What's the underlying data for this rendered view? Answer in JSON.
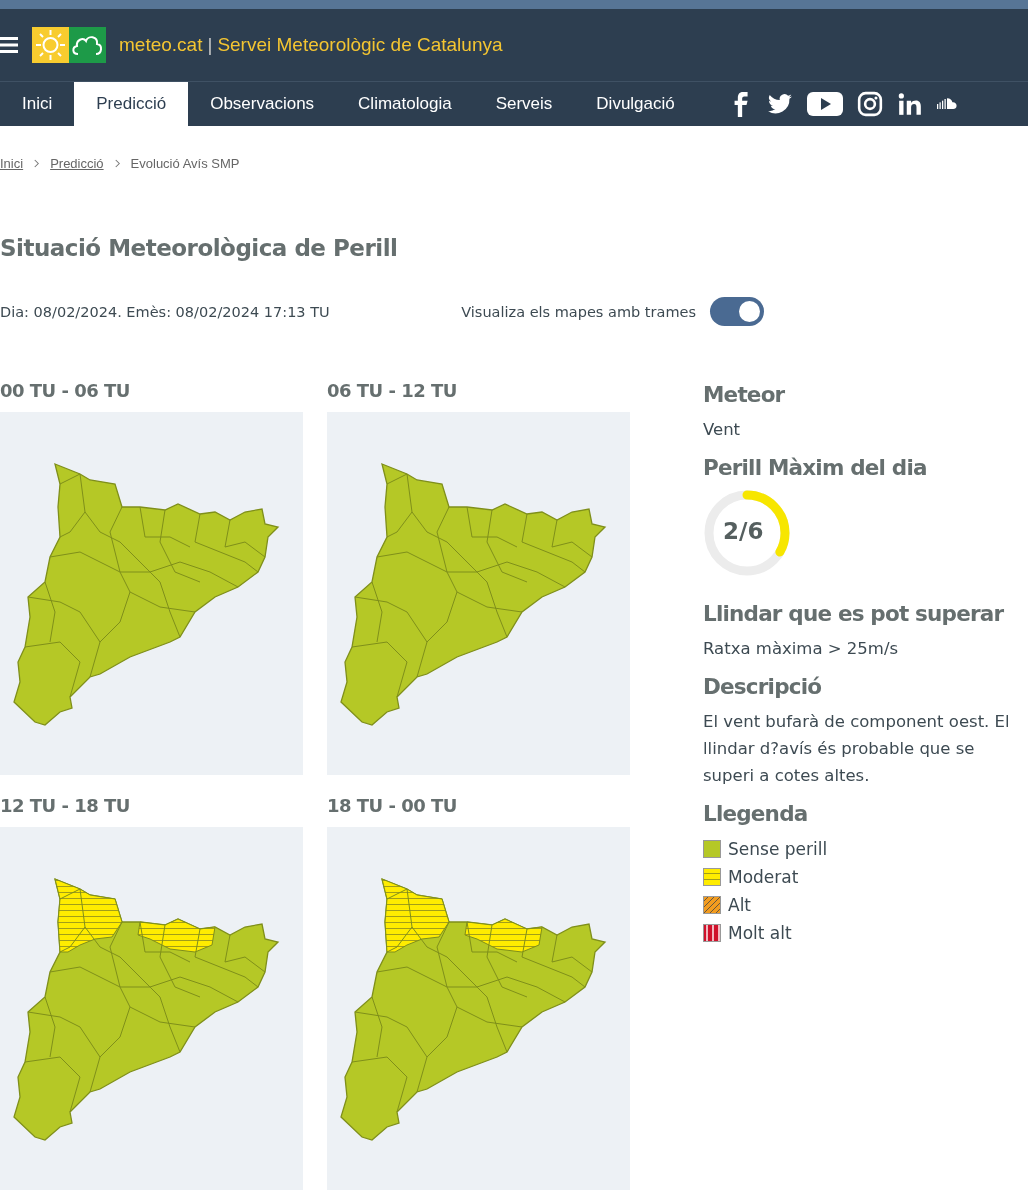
{
  "header": {
    "site": "meteo.cat",
    "separator": "|",
    "title": "Servei Meteorològic de Catalunya"
  },
  "nav": [
    {
      "label": "Inici",
      "selected": false
    },
    {
      "label": "Predicció",
      "selected": true
    },
    {
      "label": "Observacions",
      "selected": false
    },
    {
      "label": "Climatologia",
      "selected": false
    },
    {
      "label": "Serveis",
      "selected": false
    },
    {
      "label": "Divulgació",
      "selected": false
    }
  ],
  "breadcrumb": [
    {
      "label": "Inici",
      "kind": "link"
    },
    {
      "label": "Predicció",
      "kind": "link"
    },
    {
      "label": "Evolució Avís SMP",
      "kind": "current"
    }
  ],
  "page_title": "Situació Meteorològica de Perill",
  "issued": "Dia: 08/02/2024. Emès: 08/02/2024 17:13 TU",
  "pattern_toggle": {
    "label": "Visualiza els mapes amb trames",
    "on": true
  },
  "maps": [
    {
      "period": "00 TU - 06 TU",
      "moderat_zones": false
    },
    {
      "period": "06 TU - 12 TU",
      "moderat_zones": false
    },
    {
      "period": "12 TU - 18 TU",
      "moderat_zones": true
    },
    {
      "period": "18 TU - 00 TU",
      "moderat_zones": true
    }
  ],
  "details": {
    "meteor_heading": "Meteor",
    "meteor": "Vent",
    "danger_heading": "Perill Màxim del dia",
    "danger": {
      "reading": "2/6",
      "level": 0.333
    },
    "threshold_heading": "Llindar que es pot superar",
    "threshold": "Ratxa màxima > 25m/s",
    "description_heading": "Descripció",
    "description": "El vent bufarà de component oest. El llindar d?avís és probable que se superi a cotes altes.",
    "legend_heading": "Llegenda",
    "legend": [
      {
        "label": "Sense perill",
        "kind": "solid",
        "color": "#b5c826"
      },
      {
        "label": "Moderat",
        "kind": "horizontal",
        "color": "#ffec00"
      },
      {
        "label": "Alt",
        "kind": "diagonal",
        "color": "#f39c1e"
      },
      {
        "label": "Molt alt",
        "kind": "vertical",
        "color": "#d0112b"
      }
    ]
  }
}
